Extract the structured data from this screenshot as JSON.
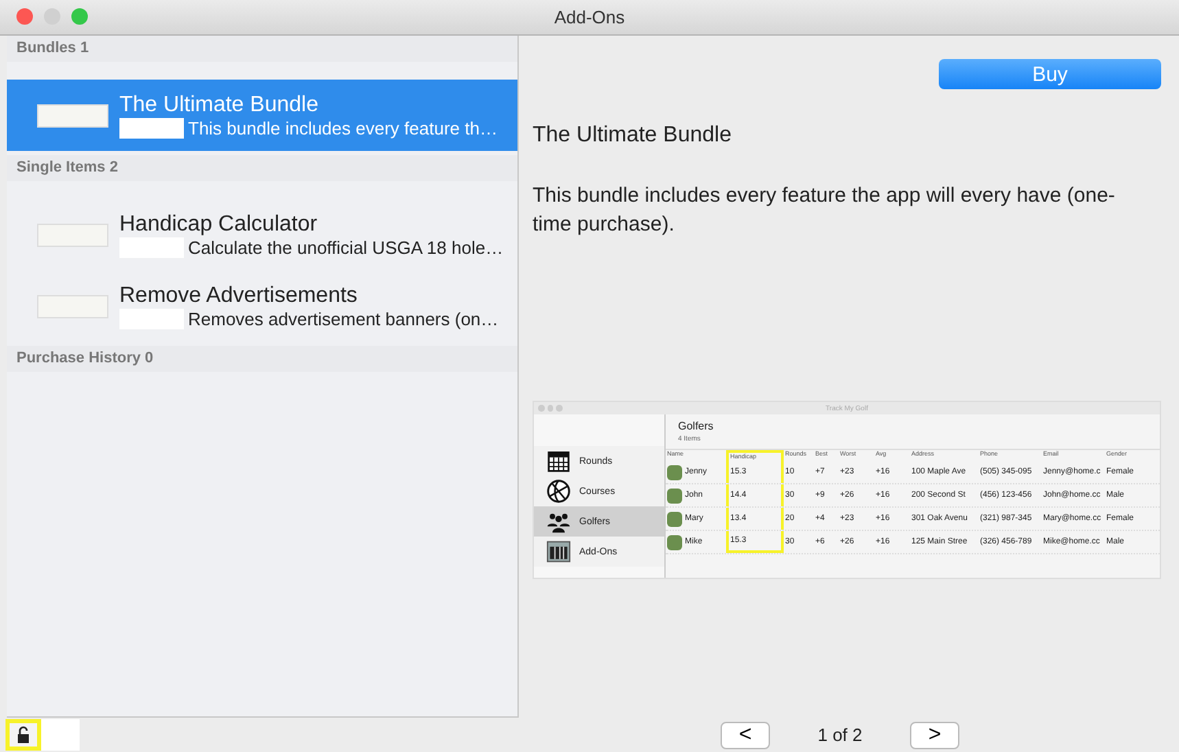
{
  "window": {
    "title": "Add-Ons"
  },
  "sections": [
    {
      "title": "Bundles 1",
      "items": [
        {
          "name": "The Ultimate Bundle",
          "description": "This bundle includes every feature th…",
          "selected": true
        }
      ]
    },
    {
      "title": "Single Items 2",
      "items": [
        {
          "name": "Handicap Calculator",
          "description": "Calculate the unofficial USGA 18 hole…",
          "selected": false
        },
        {
          "name": "Remove Advertisements",
          "description": "Removes advertisement banners (on…",
          "selected": false
        }
      ]
    },
    {
      "title": "Purchase History 0"
    }
  ],
  "detail": {
    "buy_button": "Buy",
    "title": "The Ultimate Bundle",
    "description": "This bundle includes every feature the app will every have (one-time purchase).",
    "preview": {
      "title": "Track My Golf",
      "sidebar": [
        {
          "label": "Rounds",
          "kind": "calendar",
          "selected": false
        },
        {
          "label": "Courses",
          "kind": "globe",
          "selected": false
        },
        {
          "label": "Golfers",
          "kind": "people",
          "selected": true
        },
        {
          "label": "Add-Ons",
          "kind": "store",
          "selected": false
        }
      ],
      "heading": "Golfers",
      "count": "4 Items",
      "columns": [
        {
          "label": "Name",
          "highlighted": false
        },
        {
          "label": "Handicap",
          "highlighted": true
        },
        {
          "label": "Rounds",
          "highlighted": false
        },
        {
          "label": "Best",
          "highlighted": false
        },
        {
          "label": "Worst",
          "highlighted": false
        },
        {
          "label": "Avg",
          "highlighted": false
        },
        {
          "label": "Address",
          "highlighted": false
        },
        {
          "label": "Phone",
          "highlighted": false
        },
        {
          "label": "Email",
          "highlighted": false
        },
        {
          "label": "Gender",
          "highlighted": false
        }
      ],
      "rows": [
        [
          "Jenny",
          "15.3",
          "10",
          "+7",
          "+23",
          "+16",
          "100 Maple Ave",
          "(505) 345-095",
          "Jenny@home.c",
          "Female"
        ],
        [
          "John",
          "14.4",
          "30",
          "+9",
          "+26",
          "+16",
          "200 Second St",
          "(456) 123-456",
          "John@home.cc",
          "Male"
        ],
        [
          "Mary",
          "13.4",
          "20",
          "+4",
          "+23",
          "+16",
          "301 Oak Avenu",
          "(321) 987-345",
          "Mary@home.cc",
          "Female"
        ],
        [
          "Mike",
          "15.3",
          "30",
          "+6",
          "+26",
          "+16",
          "125 Main Stree",
          "(326) 456-789",
          "Mike@home.cc",
          "Male"
        ]
      ]
    }
  },
  "pager": {
    "previous": "<",
    "page": "1 of 2",
    "next": ">"
  }
}
